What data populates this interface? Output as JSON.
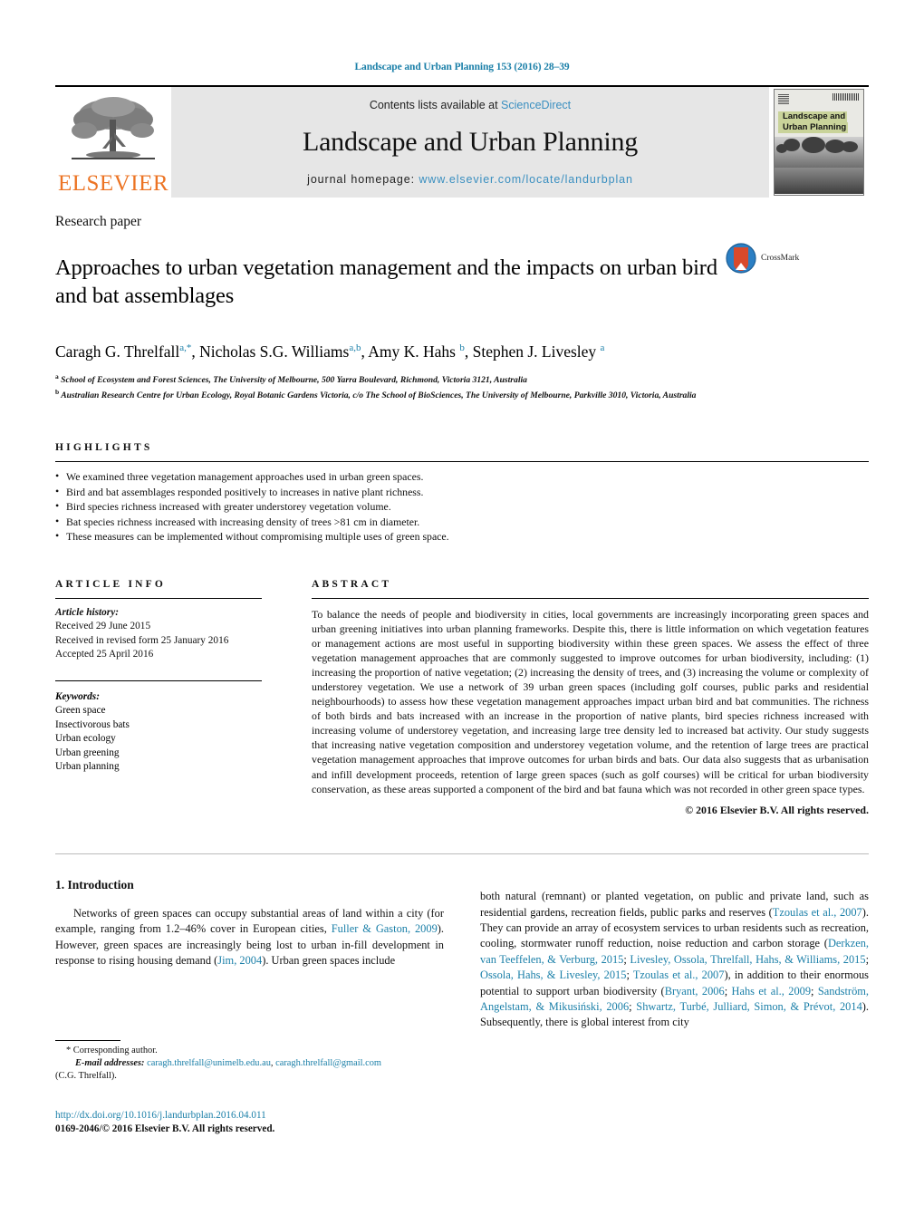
{
  "running_head": "Landscape and Urban Planning 153 (2016) 28–39",
  "masthead": {
    "publisher_name": "ELSEVIER",
    "contents_prefix": "Contents lists available at ",
    "contents_link": "ScienceDirect",
    "journal_name": "Landscape and Urban Planning",
    "homepage_prefix": "journal homepage: ",
    "homepage_url": "www.elsevier.com/locate/landurbplan",
    "cover_title_line1": "Landscape and",
    "cover_title_line2": "Urban Planning"
  },
  "article": {
    "type": "Research paper",
    "title": "Approaches to urban vegetation management and the impacts on urban bird and bat assemblages",
    "crossmark_label": "CrossMark",
    "authors_html": "Caragh G. Threlfall<sup>a,*</sup>, Nicholas S.G. Williams<sup>a,b</sup>, Amy K. Hahs <sup>b</sup>, Stephen J. Livesley <sup>a</sup>",
    "affiliation_a": "School of Ecosystem and Forest Sciences, The University of Melbourne, 500 Yarra Boulevard, Richmond, Victoria 3121, Australia",
    "affiliation_b": "Australian Research Centre for Urban Ecology, Royal Botanic Gardens Victoria, c/o The School of BioSciences, The University of Melbourne, Parkville 3010, Victoria, Australia"
  },
  "highlights": {
    "label": "HIGHLIGHTS",
    "items": [
      "We examined three vegetation management approaches used in urban green spaces.",
      "Bird and bat assemblages responded positively to increases in native plant richness.",
      "Bird species richness increased with greater understorey vegetation volume.",
      "Bat species richness increased with increasing density of trees >81 cm in diameter.",
      "These measures can be implemented without compromising multiple uses of green space."
    ]
  },
  "article_info": {
    "label": "ARTICLE INFO",
    "history_label": "Article history:",
    "history": [
      "Received 29 June 2015",
      "Received in revised form 25 January 2016",
      "Accepted 25 April 2016"
    ],
    "keywords_label": "Keywords:",
    "keywords": [
      "Green space",
      "Insectivorous bats",
      "Urban ecology",
      "Urban greening",
      "Urban planning"
    ]
  },
  "abstract": {
    "label": "ABSTRACT",
    "text": "To balance the needs of people and biodiversity in cities, local governments are increasingly incorporating green spaces and urban greening initiatives into urban planning frameworks. Despite this, there is little information on which vegetation features or management actions are most useful in supporting biodiversity within these green spaces. We assess the effect of three vegetation management approaches that are commonly suggested to improve outcomes for urban biodiversity, including: (1) increasing the proportion of native vegetation; (2) increasing the density of trees, and (3) increasing the volume or complexity of understorey vegetation. We use a network of 39 urban green spaces (including golf courses, public parks and residential neighbourhoods) to assess how these vegetation management approaches impact urban bird and bat communities. The richness of both birds and bats increased with an increase in the proportion of native plants, bird species richness increased with increasing volume of understorey vegetation, and increasing large tree density led to increased bat activity. Our study suggests that increasing native vegetation composition and understorey vegetation volume, and the retention of large trees are practical vegetation management approaches that improve outcomes for urban birds and bats. Our data also suggests that as urbanisation and infill development proceeds, retention of large green spaces (such as golf courses) will be critical for urban biodiversity conservation, as these areas supported a component of the bird and bat fauna which was not recorded in other green space types.",
    "copyright": "© 2016 Elsevier B.V. All rights reserved."
  },
  "introduction": {
    "heading": "1. Introduction",
    "left_paragraph_html": "Networks of green spaces can occupy substantial areas of land within a city (for example, ranging from 1.2–46% cover in European cities, <span class=\"ref\">Fuller &amp; Gaston, 2009</span>). However, green spaces are increasingly being lost to urban in-fill development in response to rising housing demand (<span class=\"ref\">Jim, 2004</span>). Urban green spaces include",
    "right_paragraph_html": "both natural (remnant) or planted vegetation, on public and private land, such as residential gardens, recreation fields, public parks and reserves (<span class=\"ref\">Tzoulas et al., 2007</span>). They can provide an array of ecosystem services to urban residents such as recreation, cooling, stormwater runoff reduction, noise reduction and carbon storage (<span class=\"ref\">Derkzen, van Teeffelen, &amp; Verburg, 2015</span>; <span class=\"ref\">Livesley, Ossola, Threlfall, Hahs, &amp; Williams, 2015</span>; <span class=\"ref\">Ossola, Hahs, &amp; Livesley, 2015</span>; <span class=\"ref\">Tzoulas et al., 2007</span>), in addition to their enormous potential to support urban biodiversity (<span class=\"ref\">Bryant, 2006</span>; <span class=\"ref\">Hahs et al., 2009</span>; <span class=\"ref\">Sandström, Angelstam, &amp; Mikusiński, 2006</span>; <span class=\"ref\">Shwartz, Turbé, Julliard, Simon, &amp; Prévot, 2014</span>). Subsequently, there is global interest from city"
  },
  "footnote": {
    "corresponding": "* Corresponding author.",
    "email_label": "E-mail addresses:",
    "email1": "caragh.threlfall@unimelb.edu.au",
    "email2": "caragh.threlfall@gmail.com",
    "email_owner": "(C.G. Threlfall)."
  },
  "footer": {
    "doi": "http://dx.doi.org/10.1016/j.landurbplan.2016.04.011",
    "issn": "0169-2046/© 2016 Elsevier B.V. All rights reserved."
  },
  "colors": {
    "link": "#1a7fa8",
    "elsevier_orange": "#ec7424",
    "masthead_bg": "#e6e6e6",
    "cover_band": "#c9d39a"
  }
}
